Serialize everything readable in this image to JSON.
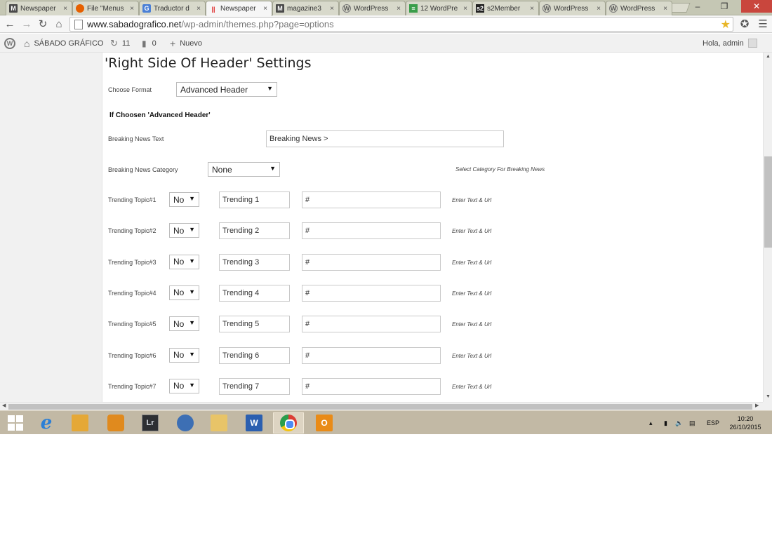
{
  "browser": {
    "tabs": [
      {
        "title": "Newspaper",
        "favicon": "M"
      },
      {
        "title": "File \"Menus",
        "favicon": "ff"
      },
      {
        "title": "Traductor d",
        "favicon": "gt"
      },
      {
        "title": "Newspaper",
        "favicon": "np",
        "active": true
      },
      {
        "title": "magazine3",
        "favicon": "M"
      },
      {
        "title": "WordPress",
        "favicon": "wp"
      },
      {
        "title": "12 WordPre",
        "favicon": "sh"
      },
      {
        "title": "s2Member",
        "favicon": "s2"
      },
      {
        "title": "WordPress",
        "favicon": "wp"
      },
      {
        "title": "WordPress",
        "favicon": "wp"
      }
    ],
    "url_host": "www.sabadografico.net",
    "url_path": "/wp-admin/themes.php?page=options",
    "favicon_letters": {
      "M": "M",
      "ff": "",
      "gt": "G",
      "np": "||",
      "wp": "W",
      "sh": "≡",
      "s2": "s2"
    }
  },
  "admin_bar": {
    "site_name": "SÁBADO GRÁFICO",
    "updates_count": "11",
    "comments_count": "0",
    "new_label": "Nuevo",
    "greeting": "Hola, admin"
  },
  "settings": {
    "title": "'Right Side Of Header' Settings",
    "choose_format_label": "Choose Format",
    "choose_format_value": "Advanced Header",
    "advanced_heading": "If Choosen 'Advanced Header'",
    "breaking_news_text_label": "Breaking News Text",
    "breaking_news_text_value": "Breaking News >",
    "breaking_news_category_label": "Breaking News Category",
    "breaking_news_category_value": "None",
    "breaking_news_category_hint": "Select Category For Breaking News",
    "trending": [
      {
        "label": "Trending Topic#1",
        "toggle": "No",
        "text": "Trending 1",
        "url": "#",
        "hint": "Enter Text & Url"
      },
      {
        "label": "Trending Topic#2",
        "toggle": "No",
        "text": "Trending 2",
        "url": "#",
        "hint": "Enter Text & Url"
      },
      {
        "label": "Trending Topic#3",
        "toggle": "No",
        "text": "Trending 3",
        "url": "#",
        "hint": "Enter Text & Url"
      },
      {
        "label": "Trending Topic#4",
        "toggle": "No",
        "text": "Trending 4",
        "url": "#",
        "hint": "Enter Text & Url"
      },
      {
        "label": "Trending Topic#5",
        "toggle": "No",
        "text": "Trending 5",
        "url": "#",
        "hint": "Enter Text & Url"
      },
      {
        "label": "Trending Topic#6",
        "toggle": "No",
        "text": "Trending 6",
        "url": "#",
        "hint": "Enter Text & Url"
      },
      {
        "label": "Trending Topic#7",
        "toggle": "No",
        "text": "Trending 7",
        "url": "#",
        "hint": "Enter Text & Url"
      }
    ]
  },
  "taskbar": {
    "apps": [
      {
        "name": "start-button",
        "icon": "windows-icon"
      },
      {
        "name": "ie",
        "icon": "internet-explorer-icon",
        "glyph": "e"
      },
      {
        "name": "app-folder",
        "icon": "folder-app-icon"
      },
      {
        "name": "app-db",
        "icon": "database-app-icon"
      },
      {
        "name": "lightroom",
        "icon": "lightroom-icon",
        "glyph": "Lr"
      },
      {
        "name": "app-blue",
        "icon": "blue-app-icon"
      },
      {
        "name": "explorer",
        "icon": "file-explorer-icon"
      },
      {
        "name": "word",
        "icon": "word-icon",
        "glyph": "W"
      },
      {
        "name": "chrome",
        "icon": "chrome-icon",
        "active": true
      },
      {
        "name": "outlook",
        "icon": "outlook-icon",
        "glyph": "O"
      }
    ],
    "language": "ESP",
    "time": "10:20",
    "date": "26/10/2015"
  }
}
